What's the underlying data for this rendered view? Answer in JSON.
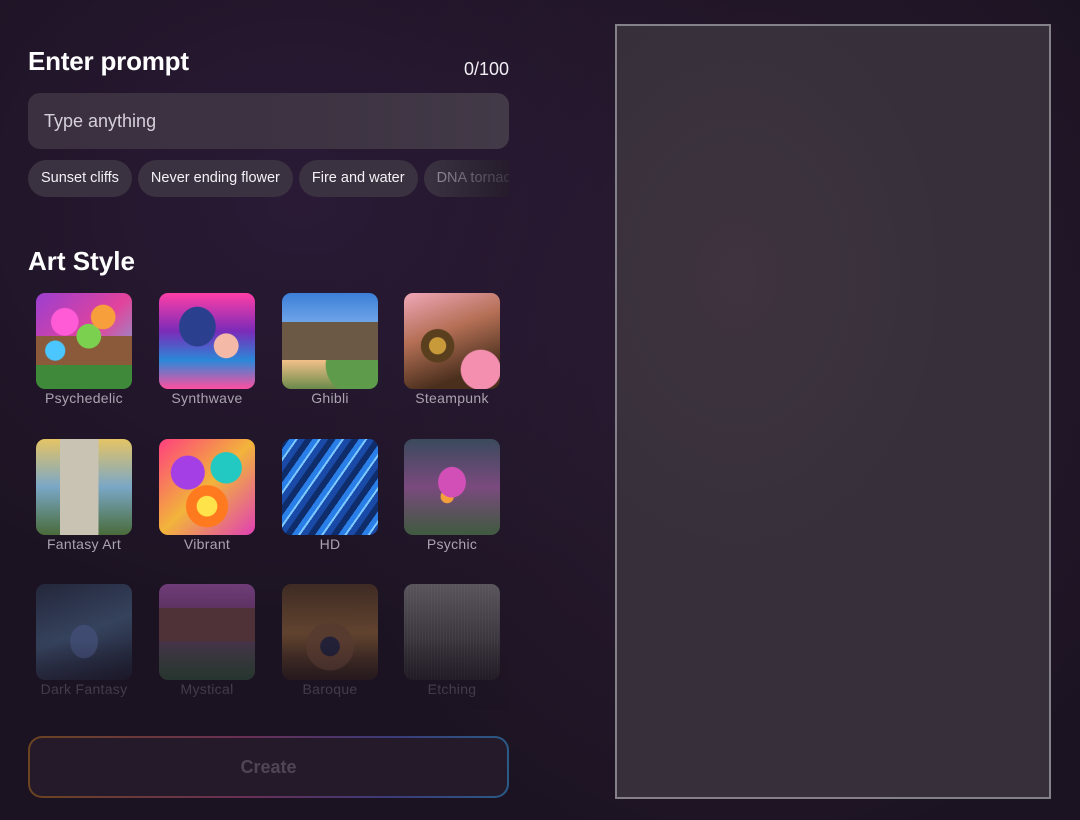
{
  "prompt": {
    "title": "Enter prompt",
    "counter": "0/100",
    "placeholder": "Type anything",
    "suggestions": [
      "Sunset cliffs",
      "Never ending flower",
      "Fire and water",
      "DNA tornado"
    ]
  },
  "art_style": {
    "title": "Art Style",
    "styles": [
      {
        "label": "Psychedelic",
        "icon": "psychedelic-tree-thumbnail"
      },
      {
        "label": "Synthwave",
        "icon": "synthwave-portrait-thumbnail"
      },
      {
        "label": "Ghibli",
        "icon": "ghibli-castle-thumbnail"
      },
      {
        "label": "Steampunk",
        "icon": "steampunk-machine-thumbnail"
      },
      {
        "label": "Fantasy Art",
        "icon": "fantasy-tower-thumbnail"
      },
      {
        "label": "Vibrant",
        "icon": "vibrant-flower-thumbnail"
      },
      {
        "label": "HD",
        "icon": "hd-waves-thumbnail"
      },
      {
        "label": "Psychic",
        "icon": "psychic-creature-thumbnail"
      },
      {
        "label": "Dark Fantasy",
        "icon": "dark-fantasy-figure-thumbnail"
      },
      {
        "label": "Mystical",
        "icon": "mystical-temple-thumbnail"
      },
      {
        "label": "Baroque",
        "icon": "baroque-eye-thumbnail"
      },
      {
        "label": "Etching",
        "icon": "etching-temple-thumbnail"
      }
    ]
  },
  "create_button": {
    "label": "Create"
  },
  "colors": {
    "background": "#1c1322",
    "input_bg": "#3a3040",
    "chip_bg": "#3a3240",
    "preview_bg": "#37303a",
    "preview_border": "#858188"
  }
}
